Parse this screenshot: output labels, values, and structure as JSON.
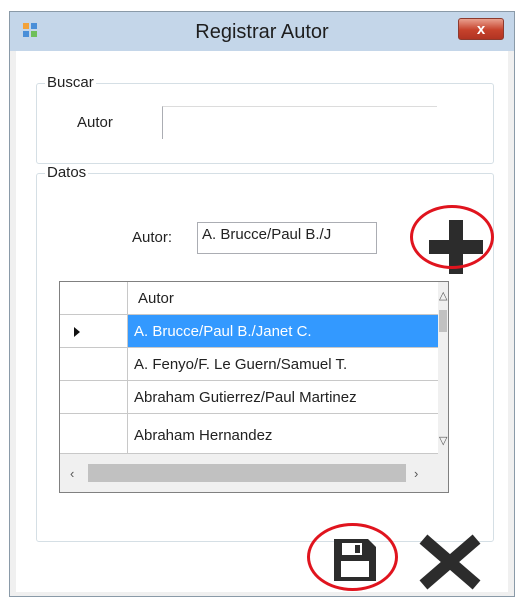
{
  "window": {
    "title": "Registrar Autor",
    "close_glyph": "x"
  },
  "buscar": {
    "legend": "Buscar",
    "label": "Autor",
    "value": ""
  },
  "datos": {
    "legend": "Datos",
    "label": "Autor:",
    "value": "A. Brucce/Paul B./J"
  },
  "grid": {
    "column_header": "Autor",
    "rows": [
      "A. Brucce/Paul B./Janet C.",
      "A. Fenyo/F. Le Guern/Samuel T.",
      "Abraham Gutierrez/Paul Martinez",
      "Abraham Hernandez"
    ],
    "selected_row": 0
  },
  "buttons": {
    "add_icon": "plus-icon",
    "save_icon": "floppy-disk-icon",
    "cancel_icon": "x-icon"
  },
  "colors": {
    "selection": "#3399ff",
    "annotation": "#e0141e",
    "icon": "#2c2c2c"
  }
}
